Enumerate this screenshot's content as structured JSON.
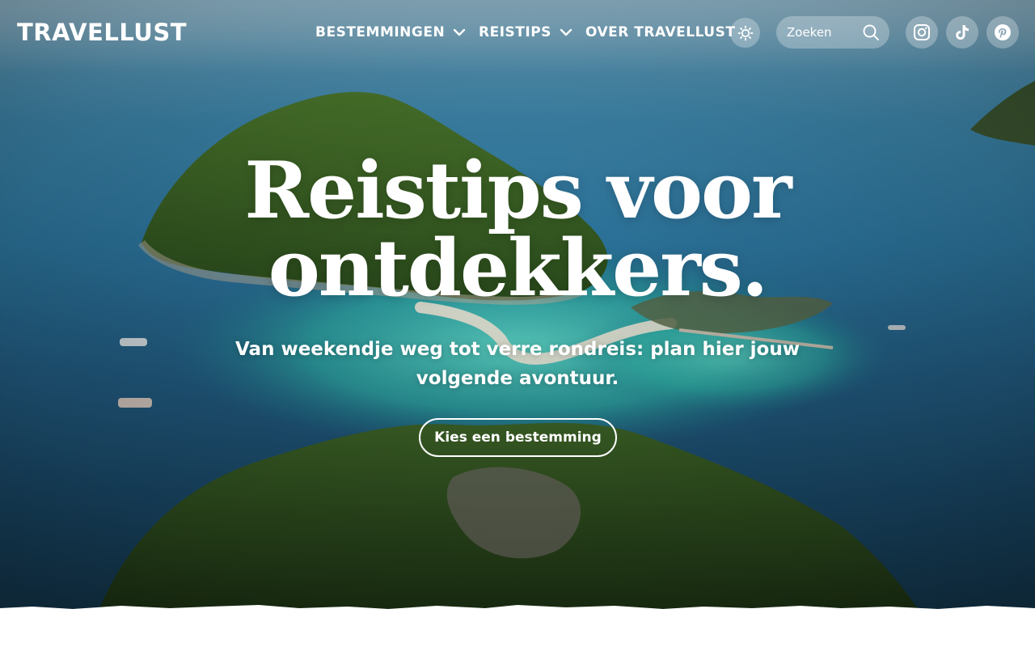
{
  "brand": {
    "logo_text": "TRAVELLUST"
  },
  "nav": {
    "items": [
      {
        "label": "BESTEMMINGEN",
        "has_dropdown": true
      },
      {
        "label": "REISTIPS",
        "has_dropdown": true
      },
      {
        "label": "OVER TRAVELLUST",
        "has_dropdown": false
      }
    ]
  },
  "header_tools": {
    "theme_toggle_icon": "sun-icon",
    "search": {
      "placeholder": "Zoeken",
      "value": "",
      "icon": "search-icon"
    },
    "social": [
      {
        "name": "Instagram",
        "icon": "instagram-icon"
      },
      {
        "name": "TikTok",
        "icon": "tiktok-icon"
      },
      {
        "name": "Pinterest",
        "icon": "pinterest-icon"
      }
    ]
  },
  "hero": {
    "headline_line1": "Reistips voor",
    "headline_line2": "ontdekkers.",
    "subtitle": "Van weekendje weg tot verre rondreis: plan hier jouw volgende avontuur.",
    "cta_label": "Kies een bestemming"
  },
  "colors": {
    "text": "#ffffff",
    "sea_deep": "#1a4a6a",
    "sea_light": "#3f8bb2",
    "lagoon": "#38c2b4",
    "island_green": "#2f5a22",
    "sand": "#e9e2cf",
    "page_bg": "#ffffff"
  }
}
